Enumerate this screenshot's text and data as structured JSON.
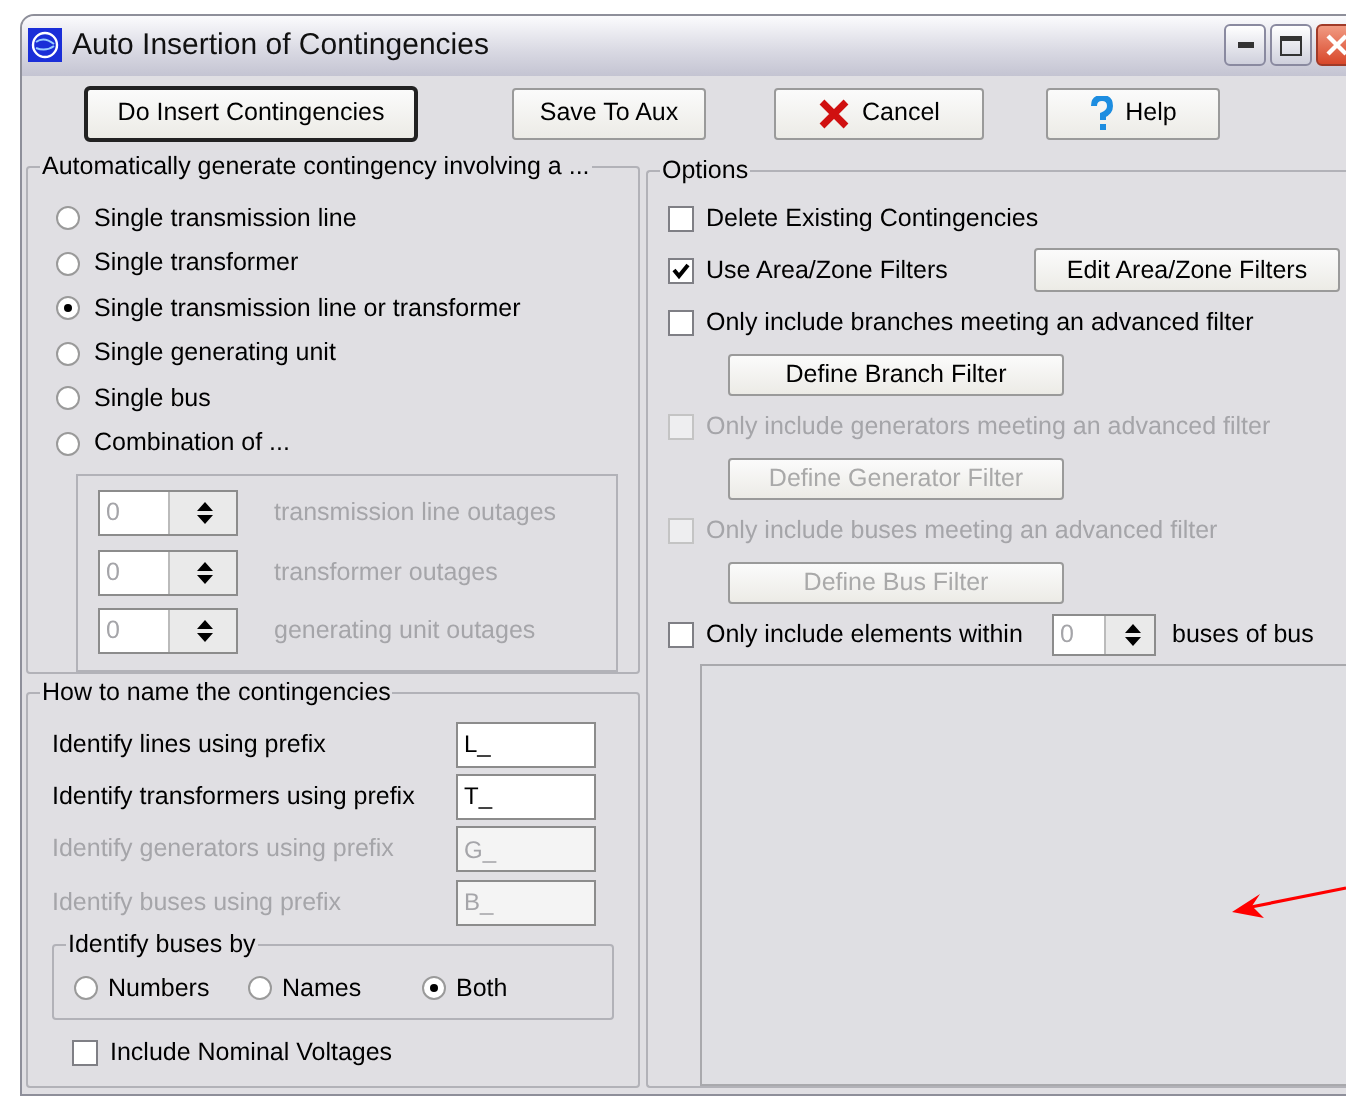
{
  "window": {
    "title": "Auto Insertion of Contingencies"
  },
  "toolbar": [
    {
      "label": "Do Insert Contingencies",
      "kind": "default"
    },
    {
      "label": "Save To Aux",
      "kind": "plain"
    },
    {
      "label": "Cancel",
      "kind": "cancel"
    },
    {
      "label": "Help",
      "kind": "help"
    }
  ],
  "generate_group": {
    "title": "Automatically generate contingency involving a ...",
    "options": [
      {
        "label": "Single transmission line",
        "selected": false
      },
      {
        "label": "Single transformer",
        "selected": false
      },
      {
        "label": "Single transmission line or transformer",
        "selected": true
      },
      {
        "label": "Single generating unit",
        "selected": false
      },
      {
        "label": "Single bus",
        "selected": false
      },
      {
        "label": "Combination of ...",
        "selected": false
      }
    ],
    "combination": [
      {
        "value": "0",
        "label": "transmission line outages",
        "disabled": true
      },
      {
        "value": "0",
        "label": "transformer outages",
        "disabled": true
      },
      {
        "value": "0",
        "label": "generating unit outages",
        "disabled": true
      }
    ]
  },
  "naming_group": {
    "title": "How to name the contingencies",
    "prefixes": [
      {
        "label": "Identify lines using prefix",
        "value": "L_",
        "disabled": false
      },
      {
        "label": "Identify transformers using prefix",
        "value": "T_",
        "disabled": false
      },
      {
        "label": "Identify generators using prefix",
        "value": "G_",
        "disabled": true
      },
      {
        "label": "Identify buses using prefix",
        "value": "B_",
        "disabled": true
      }
    ],
    "buses_by": {
      "title": "Identify buses by",
      "options": [
        {
          "label": "Numbers",
          "selected": false
        },
        {
          "label": "Names",
          "selected": false
        },
        {
          "label": "Both",
          "selected": true
        }
      ]
    },
    "nominal_voltages": {
      "label": "Include Nominal Voltages",
      "checked": false
    }
  },
  "options_group": {
    "title": "Options",
    "items": [
      {
        "kind": "check",
        "label": "Delete Existing Contingencies",
        "checked": false,
        "disabled": false
      },
      {
        "kind": "check_with_button",
        "label": "Use Area/Zone Filters",
        "checked": true,
        "disabled": false,
        "button": "Edit Area/Zone Filters"
      },
      {
        "kind": "check",
        "label": "Only include branches meeting an advanced filter",
        "checked": false,
        "disabled": false
      },
      {
        "kind": "button",
        "label": "Define Branch Filter",
        "disabled": false
      },
      {
        "kind": "check",
        "label": "Only include generators meeting an advanced filter",
        "checked": false,
        "disabled": true
      },
      {
        "kind": "button",
        "label": "Define Generator Filter",
        "disabled": true
      },
      {
        "kind": "check",
        "label": "Only include buses meeting an advanced filter",
        "checked": false,
        "disabled": true
      },
      {
        "kind": "button",
        "label": "Define Bus Filter",
        "disabled": true
      },
      {
        "kind": "check_with_spinner",
        "label": "Only include elements within",
        "checked": false,
        "disabled": false,
        "value": "0",
        "value_disabled": true,
        "suffix": "buses of bus"
      }
    ]
  }
}
